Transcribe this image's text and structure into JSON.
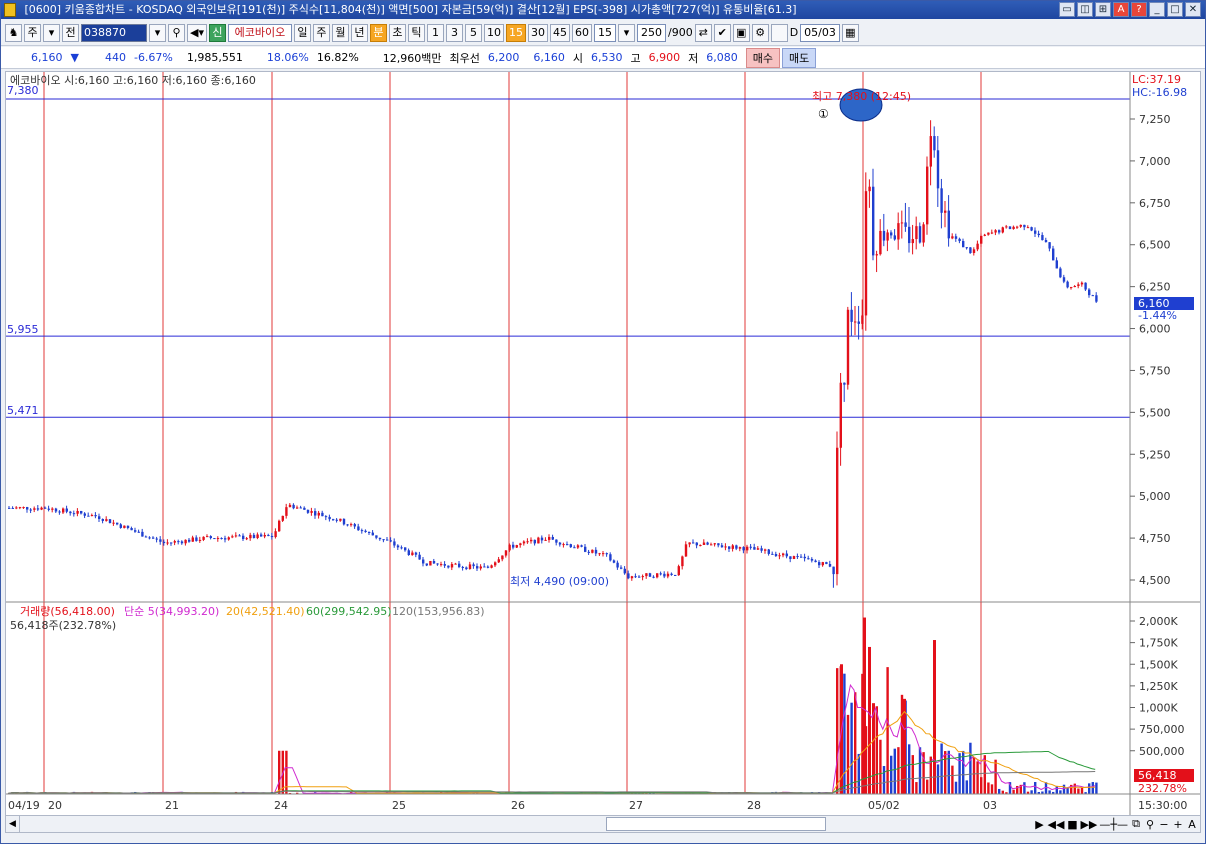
{
  "window": {
    "title": "[0600] 키움종합차트 - KOSDAQ 외국인보유[191(천)] 주식수[11,804(천)] 액면[500] 자본금[59(억)] 결산[12월] EPS[-398] 시가총액[727(억)] 유통비율[61.3]",
    "buttons": [
      "▭",
      "◫",
      "⊞",
      "A",
      "?",
      "_",
      "□",
      "✕"
    ]
  },
  "toolbar": {
    "btn_ju": "주",
    "btn_jeon": "전",
    "code": "038870",
    "new_badge": "신",
    "stock_name": "에코바이오",
    "periods": [
      "일",
      "주",
      "월",
      "년",
      "분",
      "초",
      "틱"
    ],
    "selected_period": "분",
    "intervals": [
      "1",
      "3",
      "5",
      "10",
      "15",
      "30",
      "45",
      "60"
    ],
    "selected_interval": "15",
    "interval_value": "15",
    "count_value": "250",
    "count_total": "/900",
    "checkbox_label": "D",
    "date_value": "05/03"
  },
  "quote": {
    "price": "6,160",
    "arrow": "▼",
    "change": "440",
    "change_pct": "-6.67%",
    "volume": "1,985,551",
    "turnover1": "18.06%",
    "turnover2": "16.82%",
    "amount": "12,960백만",
    "best_label": "최우선",
    "best_bid": "6,200",
    "best_ask": "6,160",
    "open_label": "시",
    "open": "6,530",
    "high_label": "고",
    "high": "6,900",
    "low_label": "저",
    "low": "6,080",
    "buy_label": "매수",
    "sell_label": "매도"
  },
  "price_panel": {
    "legend": "에코바이오 시:6,160 고:6,160 저:6,160 종:6,160",
    "lc": "LC:37.19",
    "hc": "HC:-16.98",
    "hline_labels": [
      "7,380",
      "5,955",
      "5,471"
    ],
    "high_annot": "최고 7,380 (12:45)",
    "low_annot": "최저 4,490 (09:00)",
    "marker": "①",
    "last_price_box": "6,160",
    "last_price_pct": "-1.44%",
    "y_ticks": [
      "7,250",
      "7,000",
      "6,750",
      "6,500",
      "6,250",
      "6,000",
      "5,750",
      "5,500",
      "5,250",
      "5,000",
      "4,750",
      "4,500"
    ]
  },
  "volume_panel": {
    "legend_title": "거래량(56,418.00)",
    "legend_ma5": "단순 5(34,993.20)",
    "legend_ma20": "20(42,521.40)",
    "legend_ma60": "60(299,542.95)",
    "legend_ma120": "120(153,956.83)",
    "sub_legend": "56,418주(232.78%)",
    "last_box": "56,418",
    "last_pct": "232.78%",
    "y_ticks": [
      "2,000K",
      "1,750K",
      "1,500K",
      "1,250K",
      "1,000K",
      "750,000",
      "500,000"
    ]
  },
  "x_axis": {
    "labels": [
      "04/19",
      "20",
      "21",
      "24",
      "25",
      "26",
      "27",
      "28",
      "05/02",
      "03"
    ],
    "time": "15:30:00"
  },
  "colors": {
    "up": "#e3101a",
    "down": "#1f3fd0",
    "hline": "#2a2ad6",
    "vline": "#e03a3a",
    "ma5": "#d02ad0",
    "ma20": "#f0a010",
    "ma60": "#2a9a3a",
    "ma120": "#777777"
  },
  "chart_data": {
    "type": "candlestick",
    "interval": "15min",
    "price_ylim": [
      4400,
      7400
    ],
    "volume_ylim": [
      0,
      2100000
    ],
    "ohlc_keypoints": [
      {
        "x": "04/19",
        "close": 4930
      },
      {
        "x": "04/20",
        "close": 4900
      },
      {
        "x": "04/21",
        "close": 4700
      },
      {
        "x": "04/24",
        "close": 4950
      },
      {
        "x": "04/25",
        "close": 4580
      },
      {
        "x": "04/26",
        "close": 4700
      },
      {
        "x": "04/27",
        "close": 4490
      },
      {
        "x": "04/28",
        "close": 4570
      },
      {
        "x": "05/02",
        "open": 4600,
        "high": 7380,
        "low": 4600,
        "close": 6500
      },
      {
        "x": "05/03",
        "open": 6530,
        "high": 6900,
        "low": 6080,
        "close": 6160
      }
    ],
    "hlines": [
      7380,
      5955,
      5471
    ],
    "volume_peak": 2040000
  }
}
